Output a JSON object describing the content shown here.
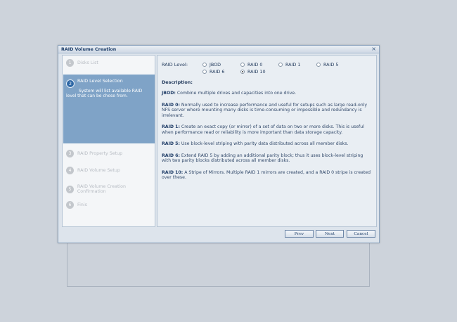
{
  "window": {
    "title": "RAID Volume Creation",
    "close_glyph": "×"
  },
  "steps": [
    {
      "num": "1",
      "label": "Disks List"
    },
    {
      "num": "2",
      "label": "RAID Level Selection",
      "description": "System will list available RAID level that can be chose from."
    },
    {
      "num": "3",
      "label": "RAID Property Setup"
    },
    {
      "num": "4",
      "label": "RAID Volume Setup"
    },
    {
      "num": "5",
      "label": "RAID Volume Creation Confirmation"
    },
    {
      "num": "6",
      "label": "Finis"
    }
  ],
  "raid": {
    "label": "RAID Level:",
    "options": [
      "JBOD",
      "RAID 0",
      "RAID 1",
      "RAID 5",
      "RAID 6",
      "RAID 10"
    ],
    "selected": "RAID 10"
  },
  "description": {
    "title": "Description:",
    "items": [
      {
        "name": "JBOD:",
        "text": " Combine multiple drives and capacities into one drive."
      },
      {
        "name": "RAID 0:",
        "text": " Normally used to increase performance and useful for setups such as large read-only NFS server where mounting many disks is time-consuming or impossible and redundancy is irrelevant."
      },
      {
        "name": "RAID 1:",
        "text": " Create an exact copy (or mirror) of a set of data on two or more disks. This is useful when performance read or reliability is more important than data storage capacity."
      },
      {
        "name": "RAID 5:",
        "text": " Use block-level striping with parity data distributed across all member disks."
      },
      {
        "name": "RAID 6:",
        "text": " Extend RAID 5 by adding an additional parity block; thus it uses block-level striping with two parity blocks distributed across all member disks."
      },
      {
        "name": "RAID 10:",
        "text": " A Stripe of Mirrors. Multiple RAID 1 mirrors are created, and a RAID 0 stripe is created over these."
      }
    ]
  },
  "buttons": {
    "prev": "Prev",
    "next": "Next",
    "cancel": "Cancel"
  }
}
